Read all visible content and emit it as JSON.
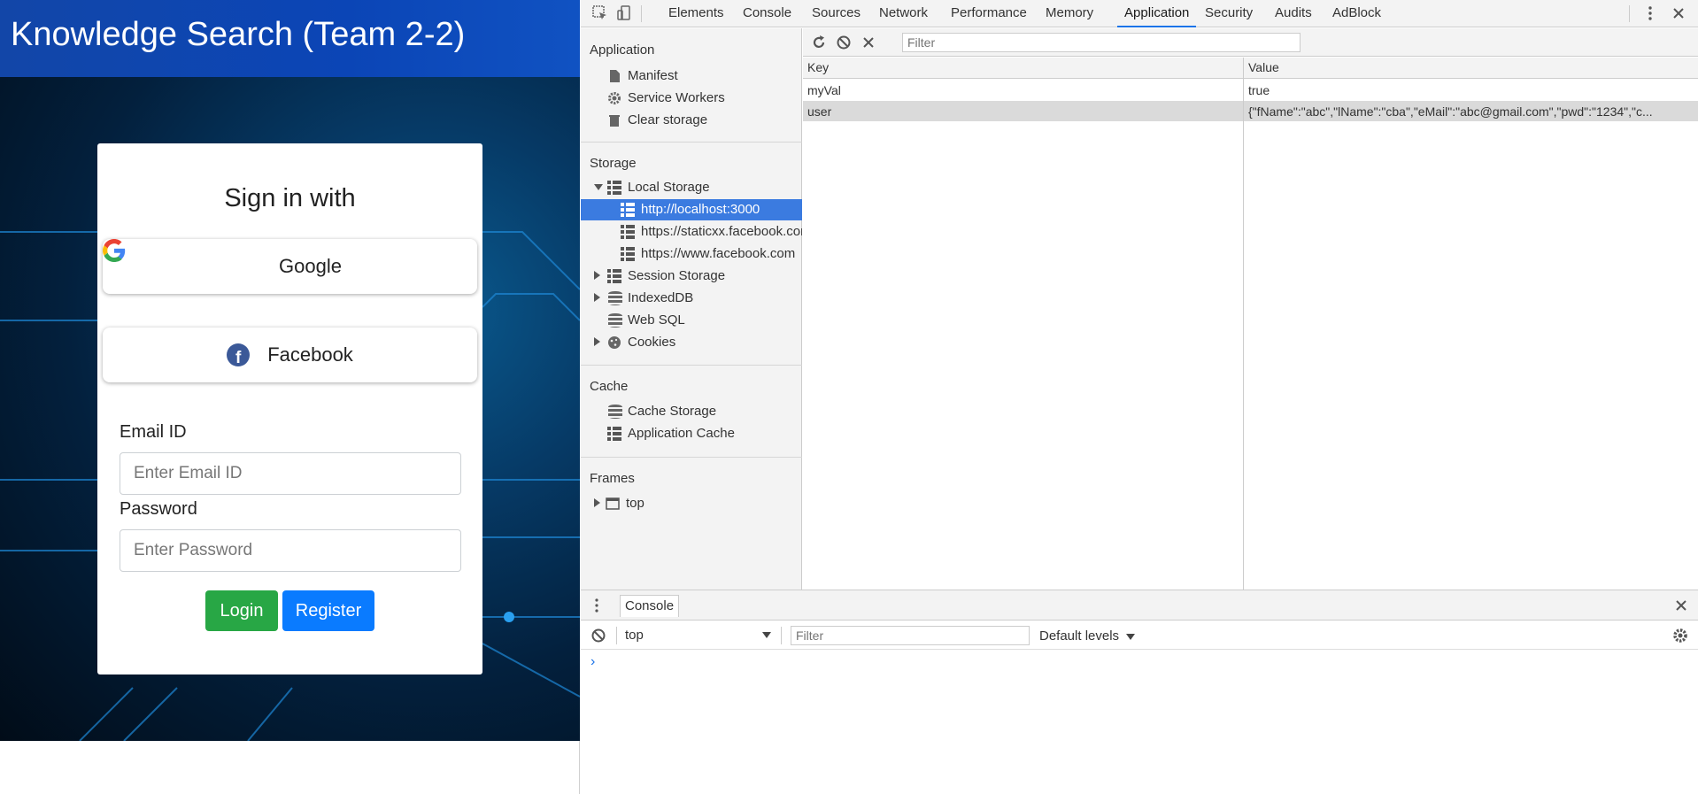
{
  "app": {
    "title": "Knowledge Search (Team 2-2)",
    "card_title": "Sign in with",
    "google_label": "Google",
    "facebook_label": "Facebook",
    "email_label": "Email ID",
    "email_placeholder": "Enter Email ID",
    "password_label": "Password",
    "password_placeholder": "Enter Password",
    "login_label": "Login",
    "register_label": "Register"
  },
  "devtools": {
    "tabs": [
      "Elements",
      "Console",
      "Sources",
      "Network",
      "Performance",
      "Memory",
      "Application",
      "Security",
      "Audits",
      "AdBlock"
    ],
    "active_tab": "Application",
    "sidebar": {
      "application_head": "Application",
      "manifest": "Manifest",
      "service_workers": "Service Workers",
      "clear_storage": "Clear storage",
      "storage_head": "Storage",
      "local_storage": "Local Storage",
      "ls_origin_1": "http://localhost:3000",
      "ls_origin_2": "https://staticxx.facebook.com",
      "ls_origin_3": "https://www.facebook.com",
      "session_storage": "Session Storage",
      "indexeddb": "IndexedDB",
      "web_sql": "Web SQL",
      "cookies": "Cookies",
      "cache_head": "Cache",
      "cache_storage": "Cache Storage",
      "application_cache": "Application Cache",
      "frames_head": "Frames",
      "frame_top": "top"
    },
    "filter_placeholder": "Filter",
    "table": {
      "headers": [
        "Key",
        "Value"
      ],
      "rows": [
        {
          "key": "myVal",
          "value": "true"
        },
        {
          "key": "user",
          "value": "{\"fName\":\"abc\",\"lName\":\"cba\",\"eMail\":\"abc@gmail.com\",\"pwd\":\"1234\",\"c..."
        }
      ]
    },
    "drawer": {
      "tab": "Console",
      "context": "top",
      "filter_placeholder": "Filter",
      "levels": "Default levels",
      "prompt": "›"
    }
  },
  "colors": {
    "header_blue": "#0b45b6",
    "login_green": "#28a745",
    "register_blue": "#0a7bff",
    "devtools_accent": "#1a73e8",
    "sidebar_selected": "#3b7be0"
  }
}
